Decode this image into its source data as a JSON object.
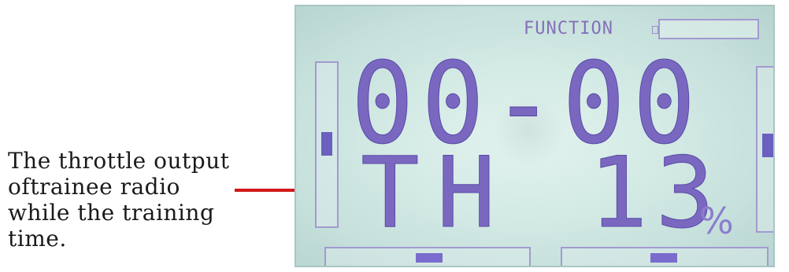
{
  "annotation": {
    "lines": [
      "The throttle output",
      "oftrainee radio",
      "while the training",
      "time."
    ],
    "pointer_color": "#d01818"
  },
  "lcd": {
    "function_label": "FUNCTION",
    "timer": "00-00",
    "mode": "TH",
    "value": "13",
    "unit": "%",
    "segment_color": "#7a68c0",
    "background_color": "#d5ebe6"
  }
}
